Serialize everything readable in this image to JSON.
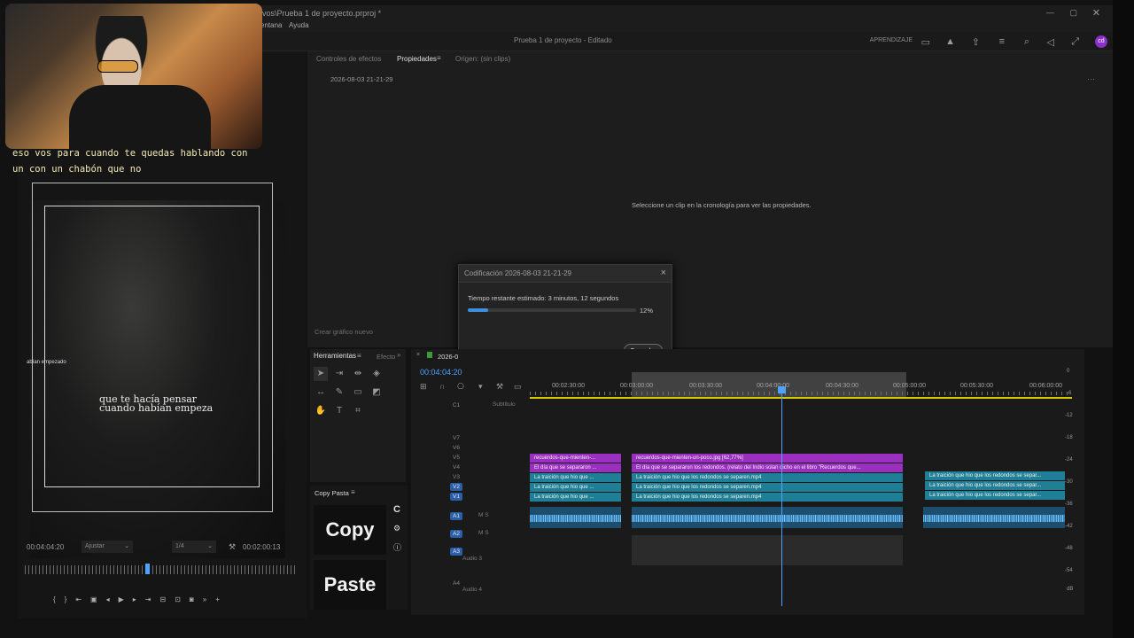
{
  "window": {
    "title": "vos\\Prueba 1 de proyecto.prproj *",
    "menu": [
      "entana",
      "Ayuda"
    ],
    "project_title": "Prueba 1 de proyecto - Editado",
    "workspace": "APRENDIZAJE"
  },
  "panels": {
    "tabs": [
      "Controles de efectos",
      "Propiedades",
      "Origen: (sin clips)"
    ],
    "sequence_name": "2026-08-03 21-21-29",
    "empty_message": "Seleccione un clip en la cronología para ver las propiedades.",
    "new_graphic": "Crear gráfico nuevo"
  },
  "encode_dialog": {
    "title": "Codificación 2026-08-03 21-21-29",
    "estimate": "Tiempo restante estimado: 3 minutos, 12 segundos",
    "progress": 0.12,
    "progress_label": "12%",
    "cancel_label": "Cancelar"
  },
  "tools": {
    "title": "Herramientas",
    "effects_tab": "Efecto"
  },
  "copypasta": {
    "title": "Copy Pasta",
    "copy_label": "Copy",
    "paste_label": "Paste",
    "c_label": "C"
  },
  "timeline": {
    "tab": "2026-0",
    "timecode": "00:04:04:20",
    "ruler": [
      "00:02:30:00",
      "00:03:00:00",
      "00:03:30:00",
      "00:04:00:00",
      "00:04:30:00",
      "00:05:00:00",
      "00:05:30:00",
      "00:06:00:00"
    ],
    "tracks": [
      {
        "name": "C1",
        "extra": "Subtítulo"
      },
      {
        "name": "V7",
        "extra": ""
      },
      {
        "name": "V6",
        "extra": ""
      },
      {
        "name": "V5",
        "extra": ""
      },
      {
        "name": "V4",
        "extra": ""
      },
      {
        "name": "V3",
        "extra": ""
      },
      {
        "name": "V2",
        "extra": ""
      },
      {
        "name": "V1",
        "extra": ""
      },
      {
        "name": "A1",
        "extra": "M  S"
      },
      {
        "name": "A2",
        "extra": "M  S"
      },
      {
        "name": "A3",
        "extra": "Audio 3"
      },
      {
        "name": "A4",
        "extra": "Audio 4"
      }
    ],
    "clips": {
      "v5_a": "recuerdos-que-mienten-...",
      "v5_b": "recuerdos-que-mienten-un-poco.jpg [62,77%]",
      "v4_a": "El día que se separaron ...",
      "v4_b": "El día que se separaron los redondos. (relato del Indio solari dicho en el  libro \"Recuerdos que...",
      "v_a": "La traición que hio que ...",
      "v_b": "La traición que hio que los redondos se separen.mp4",
      "v_c": "La traición que hio que los redondos se separ..."
    },
    "meter": [
      "0",
      "-6",
      "-12",
      "-18",
      "-24",
      "-30",
      "-36",
      "-42",
      "-48",
      "-54",
      "dB"
    ]
  },
  "preview": {
    "subtitle_line1": "eso vos para cuando te quedas hablando con",
    "subtitle_line2": "un con un chabón que no",
    "video_caption_1": "que te hacía pensar",
    "video_caption_2": "cuando habían empeza",
    "side_text": "abían empezado",
    "tc_left": "00:04:04:20",
    "fit": "Ajustar",
    "resolution": "1/4",
    "tc_right": "00:02:00:13"
  }
}
